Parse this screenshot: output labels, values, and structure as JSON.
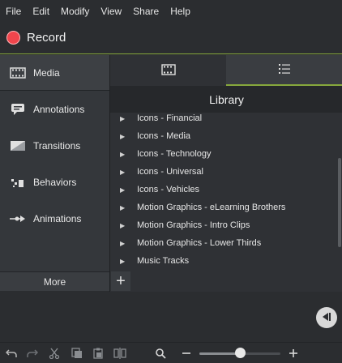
{
  "menu": [
    "File",
    "Edit",
    "Modify",
    "View",
    "Share",
    "Help"
  ],
  "record": {
    "label": "Record",
    "color": "#f0454c"
  },
  "sidebar": {
    "items": [
      {
        "label": "Media",
        "icon": "filmstrip-icon",
        "active": true
      },
      {
        "label": "Annotations",
        "icon": "speech-bubble-icon"
      },
      {
        "label": "Transitions",
        "icon": "transition-icon"
      },
      {
        "label": "Behaviors",
        "icon": "behaviors-icon"
      },
      {
        "label": "Animations",
        "icon": "animation-arrow-icon"
      }
    ],
    "more_label": "More"
  },
  "tabs": [
    {
      "icon": "filmstrip-icon",
      "active": false
    },
    {
      "icon": "list-icon",
      "active": true
    }
  ],
  "library": {
    "title": "Library",
    "items": [
      "Icons - Financial",
      "Icons - Media",
      "Icons - Technology",
      "Icons - Universal",
      "Icons - Vehicles",
      "Motion Graphics - eLearning Brothers",
      "Motion Graphics - Intro Clips",
      "Motion Graphics - Lower Thirds",
      "Music Tracks"
    ],
    "add_icon": "plus-icon"
  },
  "toolbar": {
    "icons": [
      "undo-icon",
      "redo-icon",
      "cut-icon",
      "copy-icon",
      "paste-icon",
      "split-icon",
      "zoom-search-icon",
      "zoom-out-icon",
      "zoom-in-icon"
    ],
    "zoom_level": 0.5
  },
  "accent": "#86a83c"
}
